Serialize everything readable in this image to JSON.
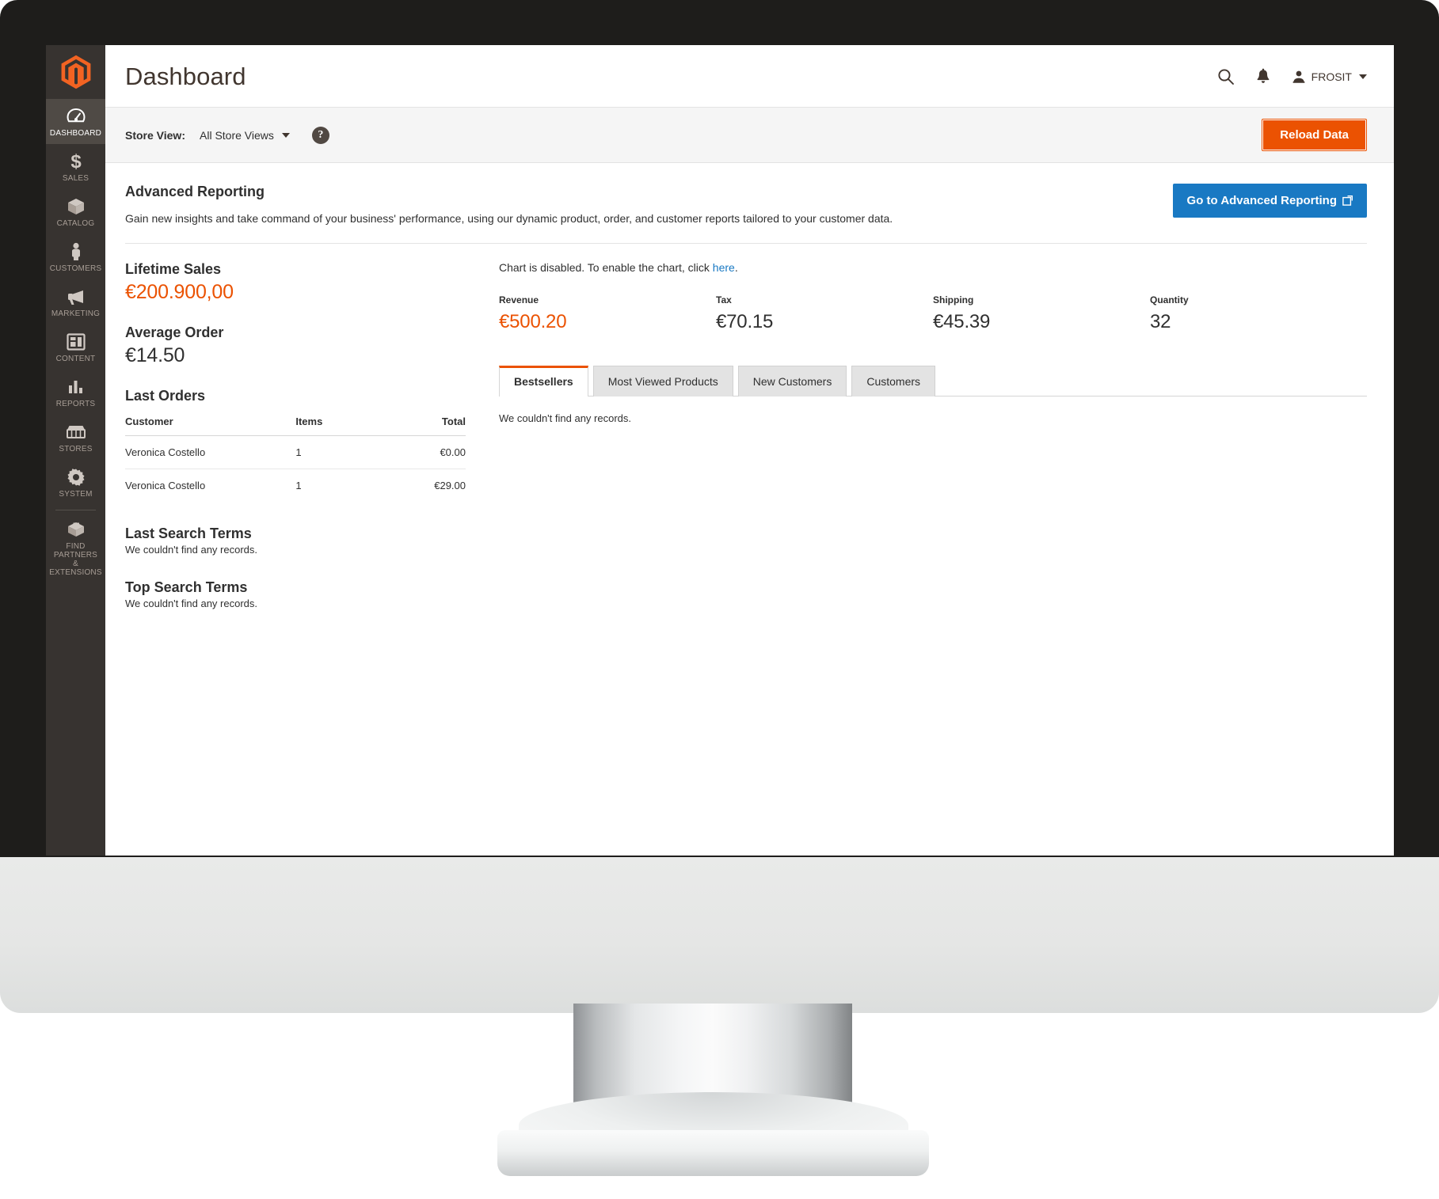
{
  "sidebar": {
    "logo_name": "magento-logo",
    "items": [
      {
        "label": "DASHBOARD",
        "icon": "dashboard-gauge-icon",
        "active": true
      },
      {
        "label": "SALES",
        "icon": "dollar-icon",
        "active": false
      },
      {
        "label": "CATALOG",
        "icon": "box-icon",
        "active": false
      },
      {
        "label": "CUSTOMERS",
        "icon": "person-icon",
        "active": false
      },
      {
        "label": "MARKETING",
        "icon": "megaphone-icon",
        "active": false
      },
      {
        "label": "CONTENT",
        "icon": "layout-icon",
        "active": false
      },
      {
        "label": "REPORTS",
        "icon": "bar-chart-icon",
        "active": false
      },
      {
        "label": "STORES",
        "icon": "storefront-icon",
        "active": false
      },
      {
        "label": "SYSTEM",
        "icon": "gear-icon",
        "active": false
      }
    ],
    "footer_item": {
      "label_line1": "FIND PARTNERS",
      "label_line2": "& EXTENSIONS",
      "icon": "extension-block-icon"
    }
  },
  "header": {
    "title": "Dashboard",
    "search_icon": "search-icon",
    "notifications_icon": "bell-icon",
    "user_icon": "user-avatar-icon",
    "user_name": "FROSIT"
  },
  "storeview": {
    "label": "Store View:",
    "selected": "All Store Views",
    "help_icon": "question-mark-icon",
    "help_glyph": "?",
    "reload_label": "Reload Data"
  },
  "advanced_reporting": {
    "title": "Advanced Reporting",
    "description": "Gain new insights and take command of your business' performance, using our dynamic product, order, and customer reports tailored to your customer data.",
    "button_label": "Go to Advanced Reporting",
    "button_icon": "external-link-icon"
  },
  "left_column": {
    "lifetime_sales": {
      "title": "Lifetime Sales",
      "value": "€200.900,00"
    },
    "average_order": {
      "title": "Average Order",
      "value": "€14.50"
    },
    "last_orders": {
      "title": "Last Orders",
      "columns": [
        "Customer",
        "Items",
        "Total"
      ],
      "rows": [
        {
          "customer": "Veronica Costello",
          "items": "1",
          "total": "€0.00"
        },
        {
          "customer": "Veronica Costello",
          "items": "1",
          "total": "€29.00"
        }
      ]
    },
    "last_search_terms": {
      "title": "Last Search Terms",
      "empty": "We couldn't find any records."
    },
    "top_search_terms": {
      "title": "Top Search Terms",
      "empty": "We couldn't find any records."
    }
  },
  "right_column": {
    "chart_notice_prefix": "Chart is disabled. To enable the chart, click ",
    "chart_notice_link": "here",
    "chart_notice_suffix": ".",
    "totals": [
      {
        "label": "Revenue",
        "value": "€500.20",
        "accent": true
      },
      {
        "label": "Tax",
        "value": "€70.15",
        "accent": false
      },
      {
        "label": "Shipping",
        "value": "€45.39",
        "accent": false
      },
      {
        "label": "Quantity",
        "value": "32",
        "accent": false
      }
    ],
    "tabs": [
      {
        "label": "Bestsellers",
        "active": true
      },
      {
        "label": "Most Viewed Products",
        "active": false
      },
      {
        "label": "New Customers",
        "active": false
      },
      {
        "label": "Customers",
        "active": false
      }
    ],
    "panel_empty": "We couldn't find any records."
  },
  "colors": {
    "accent_orange": "#eb5202",
    "link_blue": "#1979c3",
    "sidebar_bg": "#373330",
    "sidebar_active": "#4f4a45"
  }
}
